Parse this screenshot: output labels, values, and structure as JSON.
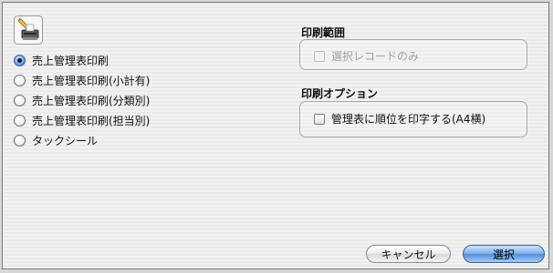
{
  "icon": {
    "name": "printer-icon"
  },
  "print_type": {
    "selected_index": 0,
    "options": [
      {
        "label": "売上管理表印刷"
      },
      {
        "label": "売上管理表印刷(小計有)"
      },
      {
        "label": "売上管理表印刷(分類別)"
      },
      {
        "label": "売上管理表印刷(担当別)"
      },
      {
        "label": "タックシール"
      }
    ]
  },
  "print_range": {
    "title": "印刷範囲",
    "selected_only_label": "選択レコードのみ",
    "selected_only_enabled": false,
    "selected_only_checked": false
  },
  "print_options": {
    "title": "印刷オプション",
    "rank_label": "管理表に順位を印字する(A4横)",
    "rank_checked": false
  },
  "buttons": {
    "cancel_label": "キャンセル",
    "select_label": "選択"
  },
  "colors": {
    "default_button": "#4f8ddc",
    "selected_radio": "#3a6fc4"
  }
}
